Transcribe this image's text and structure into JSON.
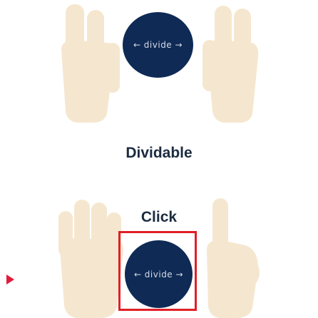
{
  "title": "Dividable",
  "instruction": "Click",
  "orb_top": {
    "label": "← divide →"
  },
  "orb_bottom": {
    "label": "← divide →"
  },
  "colors": {
    "orb": "#0e2a55",
    "hand": "#f5e7cf",
    "highlight": "#e01f26",
    "marker": "#e21b3c",
    "text": "#1c2b3f"
  },
  "icons": {
    "marker": "play-triangle-icon",
    "left_hand_top": "two-finger-hand-icon",
    "right_hand_top": "two-finger-hand-icon",
    "left_hand_bottom": "open-hand-icon",
    "right_hand_bottom": "pointing-hand-icon"
  }
}
